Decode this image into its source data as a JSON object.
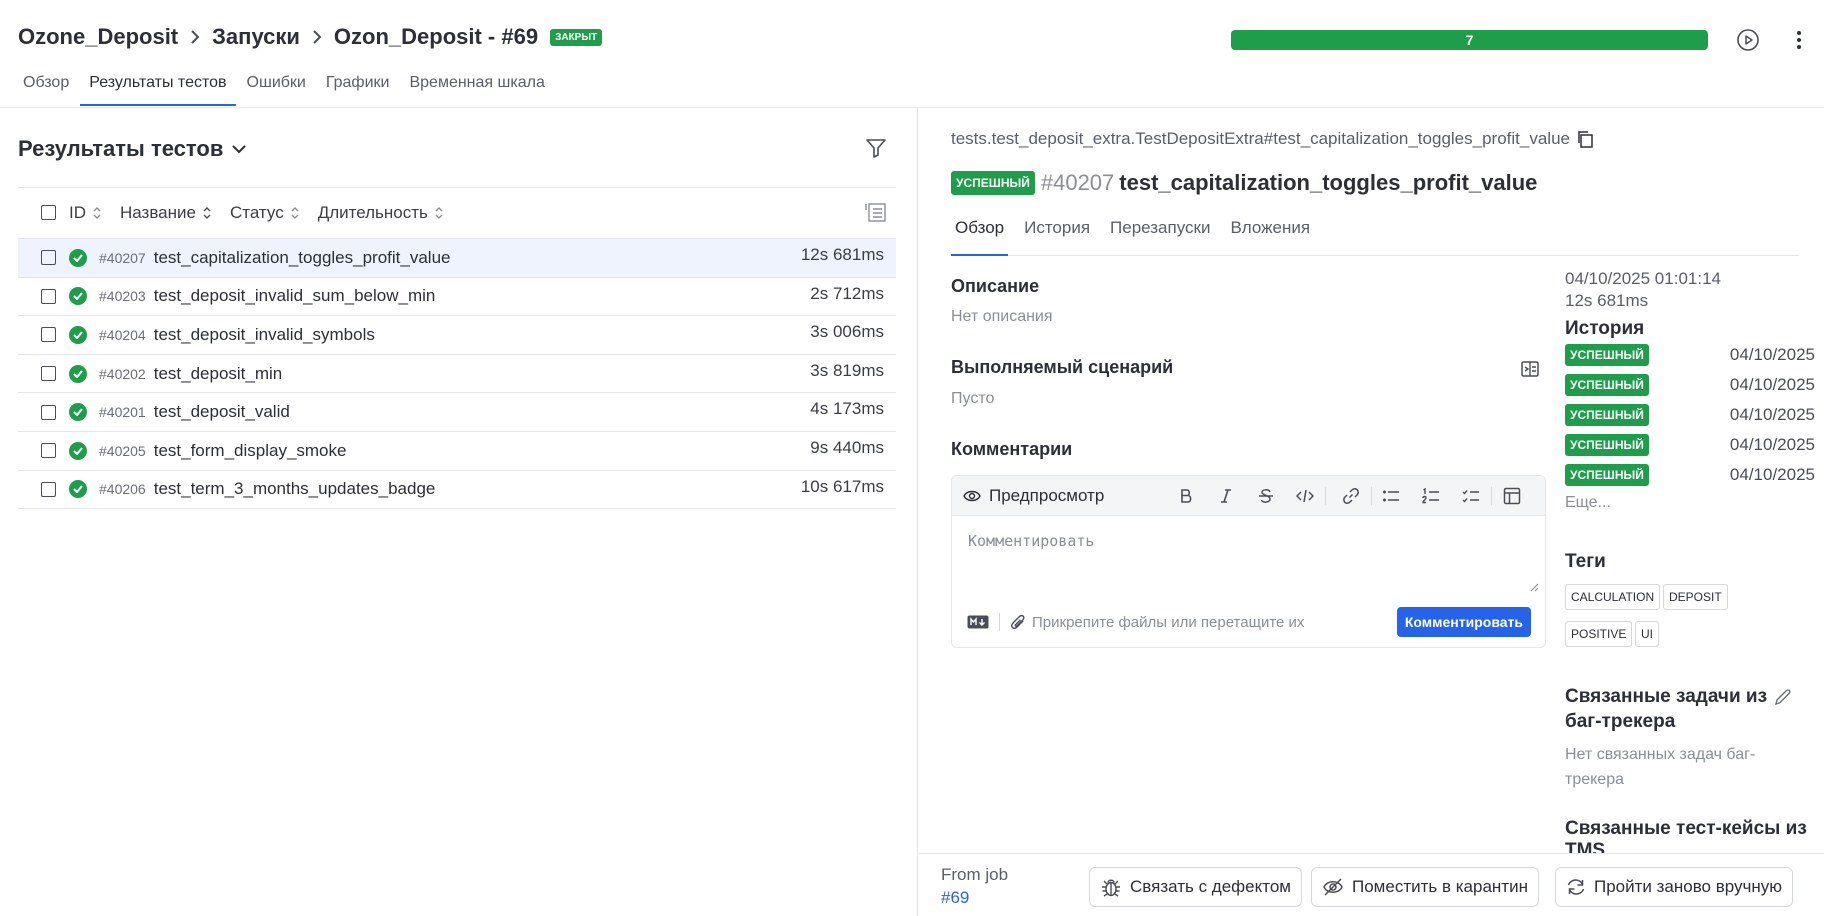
{
  "header": {
    "breadcrumbs": [
      "Ozone_Deposit",
      "Запуски",
      "Ozon_Deposit - #69"
    ],
    "closed_badge": "ЗАКРЫТ",
    "progress_label": "7",
    "progress_fraction": 1.0,
    "progress_color": "#1e9e4a",
    "tabs": [
      {
        "label": "Обзор",
        "active": false
      },
      {
        "label": "Результаты тестов",
        "active": true
      },
      {
        "label": "Ошибки",
        "active": false
      },
      {
        "label": "Графики",
        "active": false
      },
      {
        "label": "Временная шкала",
        "active": false
      }
    ],
    "icons": [
      "play-icon",
      "more-vertical-icon"
    ]
  },
  "left": {
    "title": "Результаты тестов",
    "columns": {
      "id": "ID",
      "name": "Название",
      "status": "Статус",
      "duration": "Длительность"
    },
    "rows": [
      {
        "id": "#40207",
        "name": "test_capitalization_toggles_profit_value",
        "duration": "12s 681ms",
        "status": "passed",
        "selected": true
      },
      {
        "id": "#40203",
        "name": "test_deposit_invalid_sum_below_min",
        "duration": "2s 712ms",
        "status": "passed",
        "selected": false
      },
      {
        "id": "#40204",
        "name": "test_deposit_invalid_symbols",
        "duration": "3s 006ms",
        "status": "passed",
        "selected": false
      },
      {
        "id": "#40202",
        "name": "test_deposit_min",
        "duration": "3s 819ms",
        "status": "passed",
        "selected": false
      },
      {
        "id": "#40201",
        "name": "test_deposit_valid",
        "duration": "4s 173ms",
        "status": "passed",
        "selected": false
      },
      {
        "id": "#40205",
        "name": "test_form_display_smoke",
        "duration": "9s 440ms",
        "status": "passed",
        "selected": false
      },
      {
        "id": "#40206",
        "name": "test_term_3_months_updates_badge",
        "duration": "10s 617ms",
        "status": "passed",
        "selected": false
      }
    ]
  },
  "right": {
    "full_name": "tests.test_deposit_extra.TestDepositExtra#test_capitalization_toggles_profit_value",
    "status_badge": "УСПЕШНЫЙ",
    "test_id": "#40207",
    "test_name": "test_capitalization_toggles_profit_value",
    "tabs": [
      {
        "label": "Обзор",
        "active": true
      },
      {
        "label": "История",
        "active": false
      },
      {
        "label": "Перезапуски",
        "active": false
      },
      {
        "label": "Вложения",
        "active": false
      }
    ],
    "description_title": "Описание",
    "description_text": "Нет описания",
    "scenario_title": "Выполняемый сценарий",
    "scenario_text": "Пусто",
    "comments_title": "Комментарии",
    "editor": {
      "preview_label": "Предпросмотр",
      "placeholder": "Комментировать",
      "attach_text": "Прикрепите файлы или перетащите их",
      "submit_label": "Комментировать",
      "toolbar_icons": [
        "bold-icon",
        "italic-icon",
        "strikethrough-icon",
        "code-icon",
        "link-icon",
        "bullet-list-icon",
        "numbered-list-icon",
        "task-list-icon",
        "table-icon"
      ]
    },
    "meta": {
      "datetime": "04/10/2025 01:01:14",
      "duration": "12s 681ms"
    },
    "history": {
      "title": "История",
      "items": [
        {
          "status": "УСПЕШНЫЙ",
          "date": "04/10/2025"
        },
        {
          "status": "УСПЕШНЫЙ",
          "date": "04/10/2025"
        },
        {
          "status": "УСПЕШНЫЙ",
          "date": "04/10/2025"
        },
        {
          "status": "УСПЕШНЫЙ",
          "date": "04/10/2025"
        },
        {
          "status": "УСПЕШНЫЙ",
          "date": "04/10/2025"
        }
      ],
      "more": "Еще..."
    },
    "tags": {
      "title": "Теги",
      "items": [
        "CALCULATION",
        "DEPOSIT",
        "POSITIVE",
        "UI"
      ]
    },
    "bugtracker": {
      "title": "Связанные задачи из баг-трекера",
      "text": "Нет связанных задач баг-трекера"
    },
    "testcases_title": "Связанные тест-кейсы из TMS",
    "footer": {
      "from_job_label": "From job",
      "from_job_link": "#69",
      "link_defect": "Связать с дефектом",
      "quarantine": "Поместить в карантин",
      "rerun_manual": "Пройти заново вручную"
    }
  }
}
